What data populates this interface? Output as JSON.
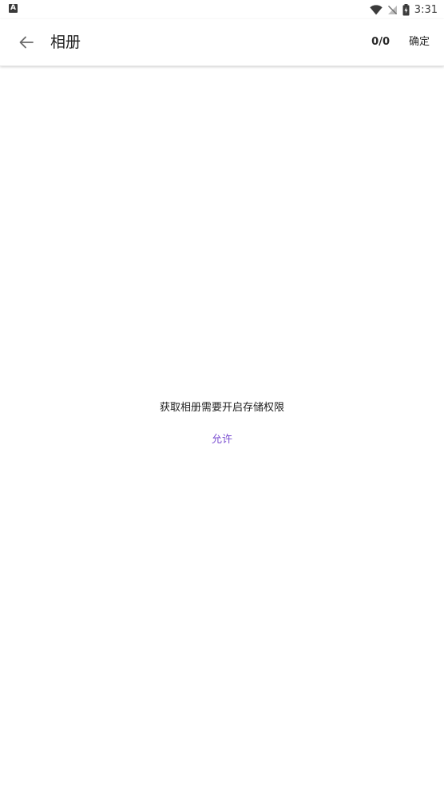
{
  "status_bar": {
    "notification_icon": "a-icon",
    "notification_letter": "A",
    "wifi_icon": "wifi-icon",
    "signal_icon": "no-signal-icon",
    "battery_icon": "battery-charging-icon",
    "time": "3:31"
  },
  "app_bar": {
    "back_icon": "arrow-left-icon",
    "title": "相册",
    "counter": "0/0",
    "confirm_label": "确定"
  },
  "content": {
    "permission_message": "获取相册需要开启存储权限",
    "allow_label": "允许"
  },
  "colors": {
    "accent": "#7b4fd1",
    "text_primary": "#202020",
    "background": "#ffffff"
  }
}
